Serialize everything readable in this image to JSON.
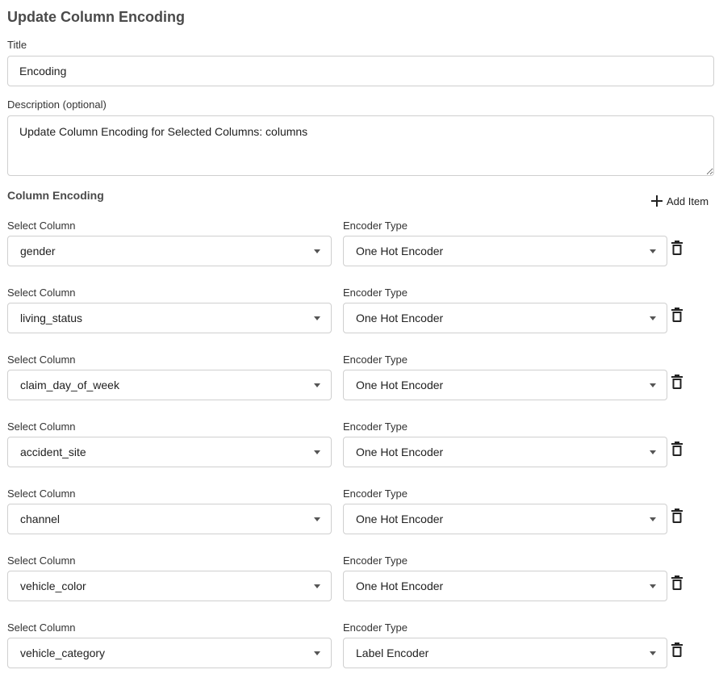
{
  "page": {
    "title": "Update Column Encoding"
  },
  "form": {
    "title_label": "Title",
    "title_value": "Encoding",
    "description_label": "Description (optional)",
    "description_value": "Update Column Encoding for Selected Columns: columns"
  },
  "encoding_section": {
    "title": "Column Encoding",
    "add_item_label": "Add Item",
    "column_label": "Select Column",
    "encoder_label": "Encoder Type",
    "rows": [
      {
        "column": "gender",
        "encoder": "One Hot Encoder"
      },
      {
        "column": "living_status",
        "encoder": "One Hot Encoder"
      },
      {
        "column": "claim_day_of_week",
        "encoder": "One Hot Encoder"
      },
      {
        "column": "accident_site",
        "encoder": "One Hot Encoder"
      },
      {
        "column": "channel",
        "encoder": "One Hot Encoder"
      },
      {
        "column": "vehicle_color",
        "encoder": "One Hot Encoder"
      },
      {
        "column": "vehicle_category",
        "encoder": "Label Encoder"
      }
    ]
  },
  "icons": {
    "add": "plus-icon",
    "delete": "trash-icon",
    "dropdown": "caret-down-icon"
  }
}
